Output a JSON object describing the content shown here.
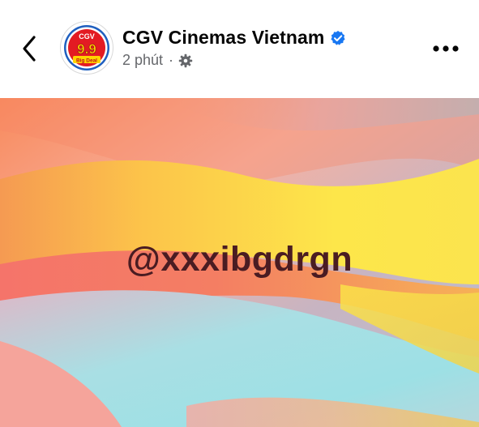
{
  "header": {
    "page_name": "CGV Cinemas Vietnam",
    "timestamp": "2 phút",
    "separator": "·",
    "verified": true,
    "audience_icon": "gear-icon",
    "back_icon": "chevron-left-icon",
    "more_icon": "more-horizontal-icon"
  },
  "avatar": {
    "logo_top": "CGV",
    "logo_number": "9.9",
    "logo_bottom": "Big Deal"
  },
  "post": {
    "overlay_text": "@xxxibgdrgn"
  },
  "colors": {
    "verified_blue": "#1877f2",
    "meta_gray": "#65676b",
    "name_black": "#050505",
    "overlay_text": "#4a1c22",
    "logo_red": "#e31b23",
    "logo_yellow": "#ffd400"
  }
}
